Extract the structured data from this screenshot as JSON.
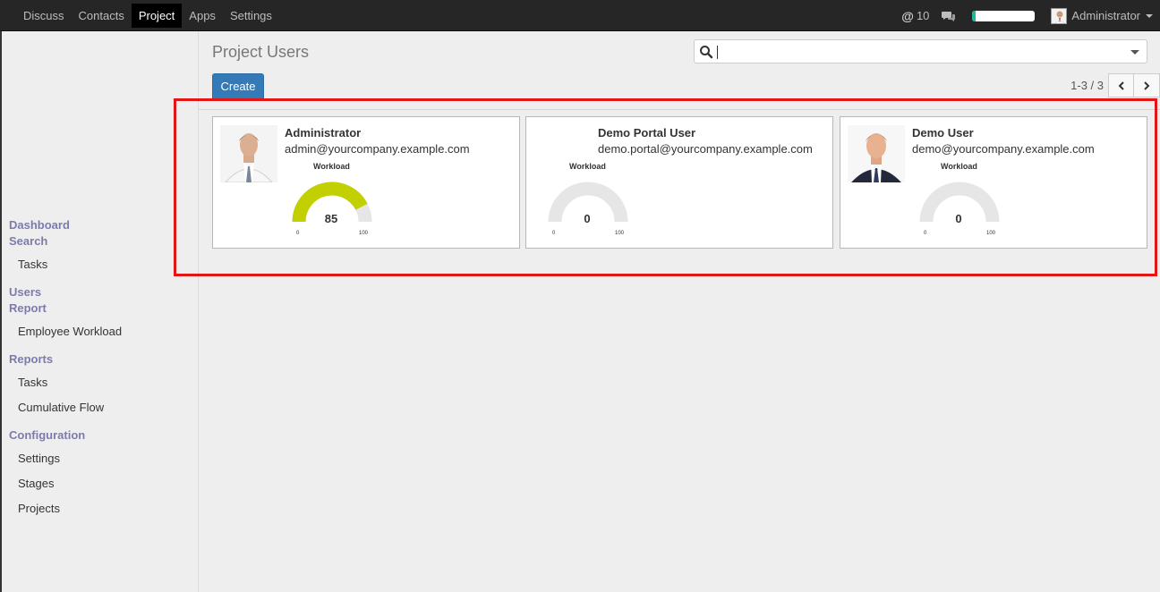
{
  "topbar": {
    "menu": [
      "Discuss",
      "Contacts",
      "Project",
      "Apps",
      "Settings"
    ],
    "active_menu": "Project",
    "mentions_count": "10",
    "progress_fraction": 0.05,
    "user_name": "Administrator",
    "accent_color": "#21b799"
  },
  "sidebar": {
    "groups": [
      {
        "label": "Dashboard"
      },
      {
        "label": "Search"
      },
      {
        "label": "Users"
      },
      {
        "label": "Report"
      },
      {
        "label": "Reports"
      },
      {
        "label": "Configuration"
      }
    ],
    "links": {
      "search_tasks": "Tasks",
      "report_employee_workload": "Employee Workload",
      "reports_tasks": "Tasks",
      "reports_cumulative_flow": "Cumulative Flow",
      "config_settings": "Settings",
      "config_stages": "Stages",
      "config_projects": "Projects"
    },
    "group_color": "#7c7bad"
  },
  "main": {
    "title": "Project Users",
    "create_label": "Create",
    "pager_value": "1-3 / 3",
    "search_value": ""
  },
  "cards": [
    {
      "name": "Administrator",
      "email": "admin@yourcompany.example.com",
      "workload_label": "Workload",
      "workload": 85,
      "min": "0",
      "max": "100",
      "photo": "man-portrait"
    },
    {
      "name": "Demo Portal User",
      "email": "demo.portal@yourcompany.example.com",
      "workload_label": "Workload",
      "workload": 0,
      "min": "0",
      "max": "100",
      "photo": "none"
    },
    {
      "name": "Demo User",
      "email": "demo@yourcompany.example.com",
      "workload_label": "Workload",
      "workload": 0,
      "min": "0",
      "max": "100",
      "photo": "young-man-portrait"
    }
  ],
  "gauge_colors": {
    "fill": "#c2cf00",
    "track": "#e6e6e6"
  },
  "highlight_color": "#e31515"
}
